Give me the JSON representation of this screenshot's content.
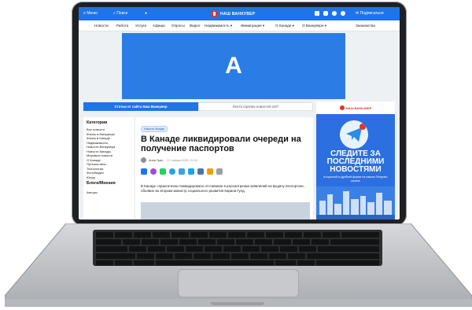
{
  "topbar": {
    "menu": "Меню",
    "search": "Поиск",
    "logo": "НАШ ВАНКУВЕР",
    "subscribe": "Подписаться",
    "social_icons": [
      "facebook-icon",
      "instagram-icon",
      "youtube-icon",
      "telegram-icon"
    ]
  },
  "nav": {
    "items": [
      "Новости",
      "Работа",
      "Услуги",
      "Афиша",
      "Опросы",
      "Видео",
      "Недвижимость ▾",
      "Иммиграция ▾",
      "О Канаде ▾",
      "О Ванкувере ▾",
      "Знакомства"
    ]
  },
  "banner": {
    "letter": "A"
  },
  "tabs": {
    "active": "Статьи от сайта Наш Ванкувер",
    "inactive": "Лента горячих новостей 24/7"
  },
  "sidebar": {
    "heading1": "Категории",
    "items": [
      "Все новости",
      "Жизнь в Ванкувере",
      "Жизнь в Канаде",
      "Недвижимость",
      "Новости Ванкувера",
      "Новости Канады",
      "Мировые новости",
      "О Канаде",
      "Путешествия",
      "Технологии",
      "Фото/Видео",
      "Юмор"
    ],
    "heading2": "Блоги/Мнения",
    "item_after": "Авторы"
  },
  "article": {
    "category": "Новости Канады",
    "title": "В Канаде ликвидировали очереди на получение паспортов",
    "author": "Анна Грин",
    "date": "· 21 января 2023, 21:04",
    "lead": "В Канаде «практически ликвидировано отставание в рассмотрении заявлений на выдачу паспортов», объявил во вторник министр социального развития Карина Гулд."
  },
  "ad": {
    "logo": "НАШ ВАНКУВЕР",
    "headline": "СЛЕДИТЕ ЗА ПОСЛЕДНИМИ НОВОСТЯМИ",
    "sub": "в короткой и удобной форме на нашем Telegram канале"
  },
  "colors": {
    "brand": "#1e74e8",
    "accent": "#e6332a"
  }
}
